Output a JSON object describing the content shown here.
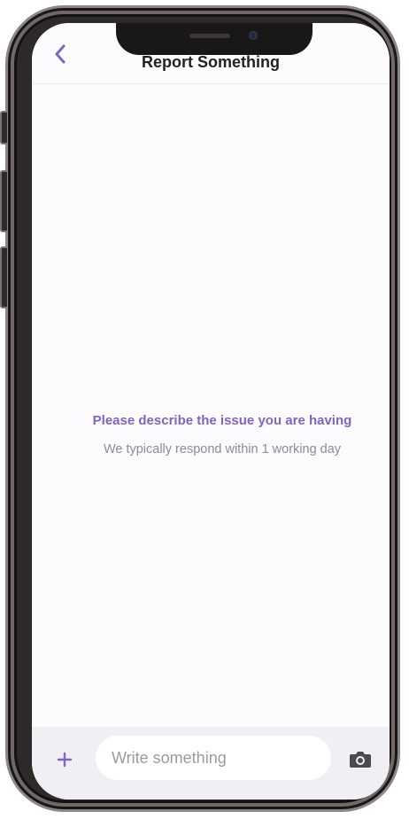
{
  "header": {
    "title": "Report Something",
    "back_icon": "chevron-left-icon"
  },
  "empty_state": {
    "title": "Please describe the issue you are having",
    "subtitle": "We typically respond within 1 working day"
  },
  "composer": {
    "add_icon": "plus-icon",
    "input_placeholder": "Write something",
    "input_value": "",
    "camera_icon": "camera-icon"
  },
  "colors": {
    "accent": "#7f64c0",
    "muted_text": "#8c8c92",
    "composer_bg": "#efeff4"
  }
}
